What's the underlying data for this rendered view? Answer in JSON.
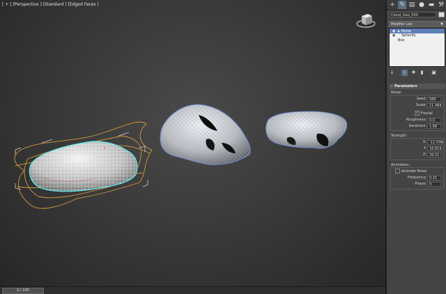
{
  "viewport": {
    "label_parts": [
      "[ + ]",
      "[Perspective ]",
      "[Standard ]",
      "[Edged Faces ]"
    ]
  },
  "timeslider": {
    "position": "0 / 100"
  },
  "command_panel": {
    "tab_icons": [
      "create-icon",
      "modify-icon",
      "hierarchy-icon",
      "motion-icon",
      "display-icon",
      "utilities-icon"
    ],
    "object_name": "Cloud_Geo_003",
    "object_color": "#dcdcdc",
    "modifier_list_label": "Modifier List",
    "stack": [
      {
        "label": "Noise",
        "selected": true,
        "expandable": true
      },
      {
        "label": "Spherify",
        "selected": false,
        "expandable": false
      },
      {
        "label": "Box",
        "selected": false,
        "expandable": false
      }
    ],
    "parameters": {
      "title": "Parameters",
      "noise_group": "Noise:",
      "seed_label": "Seed:",
      "seed_value": "586",
      "scale_label": "Scale:",
      "scale_value": "11.484",
      "fractal_label": "Fractal",
      "fractal_checked": true,
      "roughness_label": "Roughness:",
      "roughness_value": "0.0",
      "iterations_label": "Iterations:",
      "iterations_value": "1.68",
      "strength_group": "Strength:",
      "x_label": "X:",
      "x_value": "-11.574",
      "y_label": "Y:",
      "y_value": "16.615",
      "z_label": "Z:",
      "z_value": "29.51",
      "animation_group": "Animation:",
      "animate_noise_label": "Animate Noise",
      "animate_noise_checked": false,
      "frequency_label": "Frequency:",
      "frequency_value": "0.25",
      "phase_label": "Phase:",
      "phase_value": "0"
    }
  },
  "colors": {
    "selection_highlight": "#5c7fb6",
    "selected_wire": "#5ee0e0",
    "spline_orange": "#d49a3c",
    "object_wire": "#6f8fd6"
  }
}
